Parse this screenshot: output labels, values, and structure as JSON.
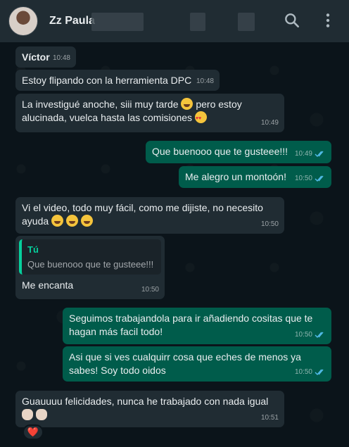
{
  "header": {
    "contact_name": "Zz Paula",
    "search_icon": "search-icon",
    "menu_icon": "more-vertical-icon"
  },
  "messages": [
    {
      "sender": "Víctor",
      "time": "10:48",
      "direction": "in"
    },
    {
      "text": "Estoy flipando con la herramienta DPC",
      "time": "10:48",
      "direction": "in"
    },
    {
      "text_a": "La investigué anoche, siii muy tarde",
      "text_b": "pero estoy alucinada, vuelca hasta las comisiones",
      "time": "10:49",
      "direction": "in"
    },
    {
      "text": "Que buenooo que te gusteee!!!",
      "time": "10:49",
      "direction": "out"
    },
    {
      "text": "Me alegro un montoón!",
      "time": "10:50",
      "direction": "out"
    },
    {
      "text_a": "Vi el video, todo muy fácil, como me dijiste, no necesito",
      "text_b": "ayuda",
      "time": "10:50",
      "direction": "in"
    },
    {
      "quote_author": "Tú",
      "quote_text": "Que buenooo que te gusteee!!!",
      "text": "Me encanta",
      "time": "10:50",
      "direction": "in"
    },
    {
      "text": "Seguimos trabajandola para ir añadiendo cositas que te hagan más facil todo!",
      "time": "10:50",
      "direction": "out"
    },
    {
      "text": "Asi que si ves cualquirr cosa que eches de menos ya sabes! Soy todo oidos",
      "time": "10:50",
      "direction": "out"
    },
    {
      "text": "Guauuuu felicidades, nunca he trabajado con nada igual",
      "time": "10:51",
      "direction": "in",
      "reaction": "❤️"
    }
  ],
  "colors": {
    "background": "#0b141a",
    "incoming": "#202c33",
    "outgoing": "#005c4b",
    "read_tick": "#53bdeb",
    "quote_accent": "#06cf9c"
  }
}
